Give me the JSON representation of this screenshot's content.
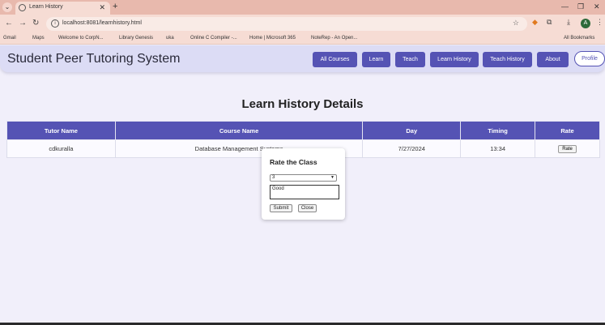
{
  "browser": {
    "tab_title": "Learn History",
    "url": "localhost:8081/learnhistory.html",
    "bookmarks": [
      "Gmail",
      "Maps",
      "Welcome to CorpN...",
      "Library Genesis",
      "uka",
      "Online C Compiler -...",
      "Home | Microsoft 365",
      "NoteRep - An Open...",
      "All Bookmarks"
    ],
    "profile_initial": "A"
  },
  "site": {
    "title": "Student Peer Tutoring System",
    "nav": [
      "All Courses",
      "Learn",
      "Teach",
      "Learn History",
      "Teach History",
      "About"
    ],
    "profile_label": "Profile"
  },
  "main": {
    "heading": "Learn History Details",
    "columns": [
      "Tutor Name",
      "Course Name",
      "Day",
      "Timing",
      "Rate"
    ],
    "rows": [
      {
        "tutor": "cdkuralla",
        "course": "Database Management Systems",
        "day": "7/27/2024",
        "timing": "13:34",
        "rate_label": "Rate"
      }
    ]
  },
  "modal": {
    "title": "Rate the Class",
    "selected_rating": "3",
    "comment": "Good",
    "submit_label": "Submit",
    "close_label": "Close"
  },
  "colors": {
    "accent": "#5553b4",
    "chrome": "#e8b9ad",
    "page_bg": "#f1effa"
  }
}
